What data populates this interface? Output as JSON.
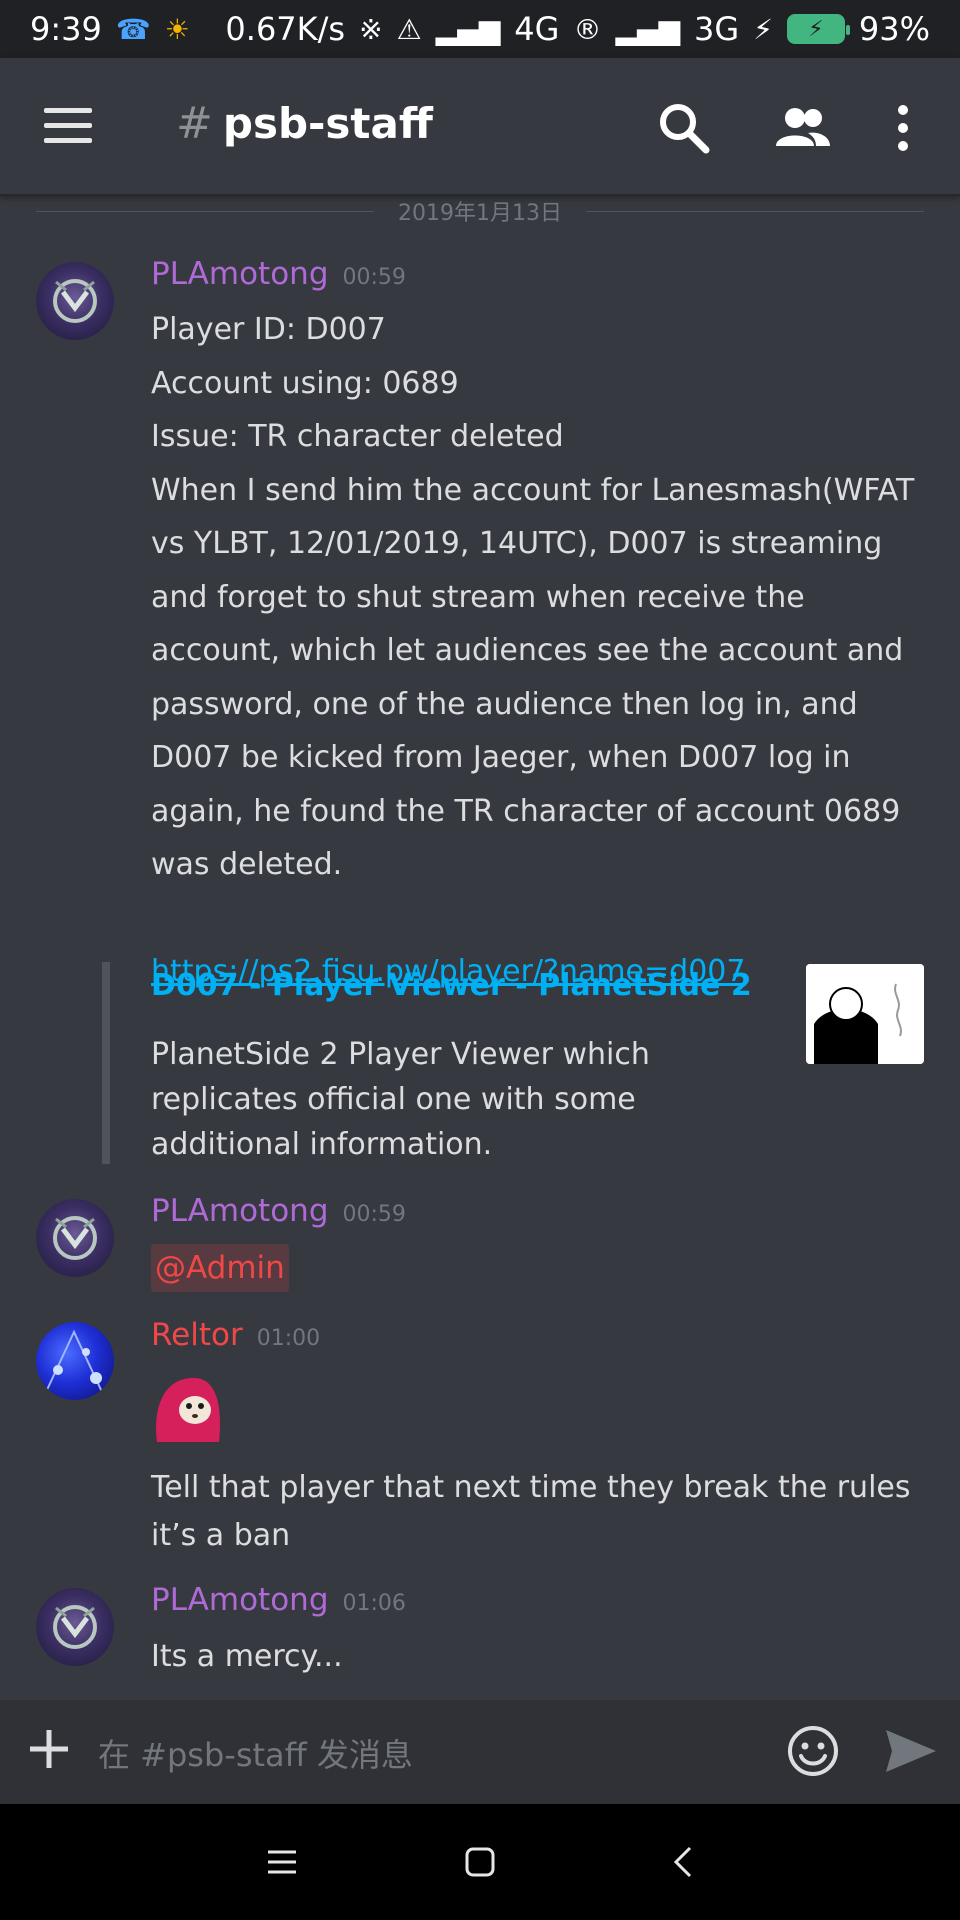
{
  "status_bar": {
    "time": "9:39",
    "network_speed": "0.67K/s",
    "network1": "4G",
    "network2": "3G",
    "battery": "93%"
  },
  "header": {
    "channel_name": "psb-staff",
    "hash": "#"
  },
  "date_divider": "2019年1月13日",
  "messages": [
    {
      "author": "PLAmotong",
      "time": "00:59",
      "lines": [
        "Player ID: D007",
        "Account using: 0689",
        "Issue: TR character deleted",
        "When I send him the account for Lanesmash(WFAT vs YLBT, 12/01/2019, 14UTC), D007 is streaming and forget to shut stream when receive the account, which let audiences see the account and password, one of the audience then log in, and D007 be kicked from Jaeger, when D007 log in again, he found the TR character of account 0689 was deleted."
      ],
      "link": "https://ps2.fisu.pw/player/?name=d007",
      "embed": {
        "title": "D007 - Player Viewer - PlanetSide 2",
        "description": "PlanetSide 2 Player Viewer which replicates official one with some additional information."
      }
    },
    {
      "author": "PLAmotong",
      "time": "00:59",
      "mention": "@Admin"
    },
    {
      "author": "Reltor",
      "time": "01:00",
      "text": "Tell that player that next time they break the rules it’s a ban"
    },
    {
      "author": "PLAmotong",
      "time": "01:06",
      "text": "Its a mercy..."
    }
  ],
  "input": {
    "placeholder": "在 #psb-staff 发消息"
  },
  "colors": {
    "background": "#36393f",
    "link": "#00b0f4",
    "author_pla": "#b06ad7",
    "author_reltor": "#f04747"
  }
}
